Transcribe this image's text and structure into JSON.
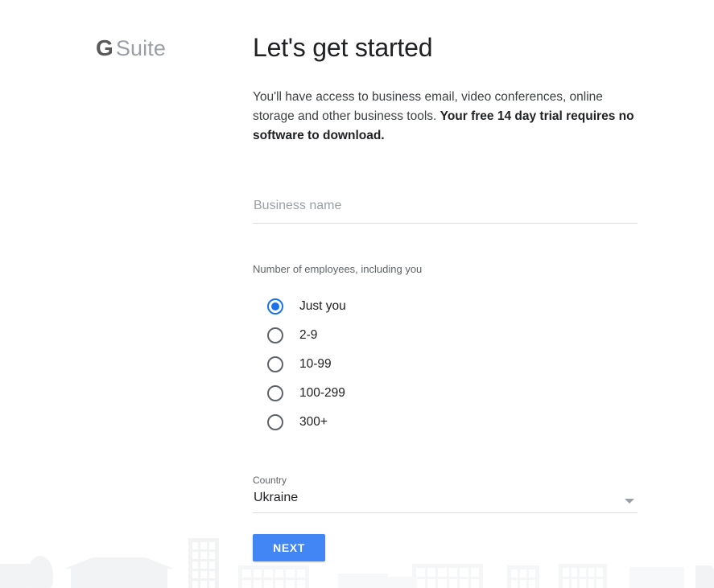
{
  "brand": {
    "logo_g": "G",
    "logo_suite": "Suite"
  },
  "header": {
    "title": "Let's get started"
  },
  "intro": {
    "text_regular": "You'll have access to business email, video conferences, online storage and other business tools. ",
    "text_bold": "Your free 14 day trial requires no software to download."
  },
  "business_name": {
    "placeholder": "Business name",
    "value": ""
  },
  "employees": {
    "label": "Number of employees, including you",
    "selected": "Just you",
    "options": [
      {
        "label": "Just you",
        "checked": true
      },
      {
        "label": "2-9",
        "checked": false
      },
      {
        "label": "10-99",
        "checked": false
      },
      {
        "label": "100-299",
        "checked": false
      },
      {
        "label": "300+",
        "checked": false
      }
    ]
  },
  "country": {
    "label": "Country",
    "value": "Ukraine",
    "arrow_icon": "chevron-down-icon"
  },
  "actions": {
    "next_label": "NEXT"
  },
  "colors": {
    "accent_blue": "#4285f4",
    "radio_blue": "#1a73e8",
    "text_primary": "#202124",
    "text_secondary": "#5f6368",
    "placeholder": "#9aa0a6",
    "underline": "#dadce0",
    "illustration": "#f1f3f4"
  }
}
